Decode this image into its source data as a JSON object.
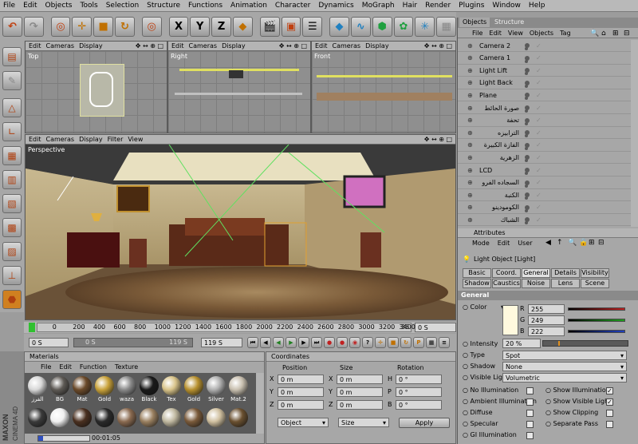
{
  "menubar": [
    "File",
    "Edit",
    "Objects",
    "Tools",
    "Selection",
    "Structure",
    "Functions",
    "Animation",
    "Character",
    "Dynamics",
    "MoGraph",
    "Hair",
    "Render",
    "Plugins",
    "Window",
    "Help"
  ],
  "toolbar": {
    "x": "X",
    "y": "Y",
    "z": "Z"
  },
  "viewports": {
    "top": {
      "menu": [
        "Edit",
        "Cameras",
        "Display"
      ],
      "label": "Top"
    },
    "right": {
      "menu": [
        "Edit",
        "Cameras",
        "Display"
      ],
      "label": "Right"
    },
    "front": {
      "menu": [
        "Edit",
        "Cameras",
        "Display"
      ],
      "label": "Front"
    },
    "perspective": {
      "menu": [
        "Edit",
        "Cameras",
        "Display",
        "Filter",
        "View"
      ],
      "label": "Perspective"
    }
  },
  "timeline": {
    "ticks": [
      "0",
      "200",
      "400",
      "600",
      "800",
      "1000",
      "1200",
      "1400",
      "1600",
      "1800",
      "2000",
      "2200",
      "2400",
      "2600",
      "2800",
      "3000",
      "3200",
      "3400"
    ],
    "end_marker": "36",
    "frame_field": "0 S",
    "start_field": "0 S",
    "range_field": "119 S",
    "scrub_label": "0 S",
    "scrub_end": "119 S"
  },
  "materials": {
    "title": "Materials",
    "menu": [
      "File",
      "Edit",
      "Function",
      "Texture"
    ],
    "row1": [
      {
        "label": "الفرز",
        "color": "#d8d8d8"
      },
      {
        "label": "BG",
        "color": "#5e5a55"
      },
      {
        "label": "Mat",
        "color": "#6b4a2a"
      },
      {
        "label": "Gold",
        "color": "#c9a23a"
      },
      {
        "label": "waza",
        "color": "#8a8a8a"
      },
      {
        "label": "Black",
        "color": "#1a1a1a"
      },
      {
        "label": "Tex",
        "color": "#d9c48a"
      },
      {
        "label": "Gold",
        "color": "#b8912f"
      },
      {
        "label": "Silver",
        "color": "#b0b0b0"
      },
      {
        "label": "Mat.2",
        "color": "#c9c0b0"
      }
    ],
    "row2": [
      "#3a3a3a",
      "#f0f0f0",
      "#4a3020",
      "#2a2a2a",
      "#8a6a50",
      "#9a8060",
      "#c0b8a0",
      "#7a5a3a",
      "#d0c0a0",
      "#6a5030"
    ],
    "status": "00:01:05"
  },
  "coordinates": {
    "title": "Coordinates",
    "headers": [
      "Position",
      "Size",
      "Rotation"
    ],
    "rows": [
      {
        "a": "X",
        "av": "0 m",
        "b": "X",
        "bv": "0 m",
        "c": "H",
        "cv": "0 °"
      },
      {
        "a": "Y",
        "av": "0 m",
        "b": "Y",
        "bv": "0 m",
        "c": "P",
        "cv": "0 °"
      },
      {
        "a": "Z",
        "av": "0 m",
        "b": "Z",
        "bv": "0 m",
        "c": "B",
        "cv": "0 °"
      }
    ],
    "mode": "Object",
    "size_mode": "Size",
    "apply": "Apply"
  },
  "objects": {
    "tabs": [
      "Objects",
      "Structure"
    ],
    "menu": [
      "File",
      "Edit",
      "View",
      "Objects",
      "Tag"
    ],
    "items": [
      "Camera 2",
      "Camera 1",
      "Light Lift",
      "Light Back",
      "Plane",
      "صورة الحائط",
      "تحفة",
      "الترابيزه",
      "الفازة الكبيرة",
      "الزهرية",
      "LCD",
      "السجاده الفرو",
      "الكنبة",
      "الكومودينو",
      "الشباك"
    ]
  },
  "attributes": {
    "title": "Attributes",
    "menu": [
      "Mode",
      "Edit",
      "User"
    ],
    "object": "Light Object [Light]",
    "tabs_row1": [
      "Basic",
      "Coord.",
      "General",
      "Details",
      "Visibility"
    ],
    "tabs_row2": [
      "Shadow",
      "Caustics",
      "Noise",
      "Lens",
      "Scene"
    ],
    "section": "General",
    "color_label": "Color",
    "r": "255",
    "g": "249",
    "b": "222",
    "swatch": "#fff9de",
    "intensity_label": "Intensity",
    "intensity": "20 %",
    "type_label": "Type",
    "type": "Spot",
    "shadow_label": "Shadow",
    "shadow": "None",
    "visible_label": "Visible Light",
    "visible": "Volumetric",
    "checks_left": [
      "No Illumination",
      "Ambient Illumination",
      "Diffuse",
      "Specular",
      "GI Illumination"
    ],
    "checks_right": [
      "Show Illumination",
      "Show Visible Light",
      "Show Clipping",
      "Separate Pass"
    ]
  }
}
